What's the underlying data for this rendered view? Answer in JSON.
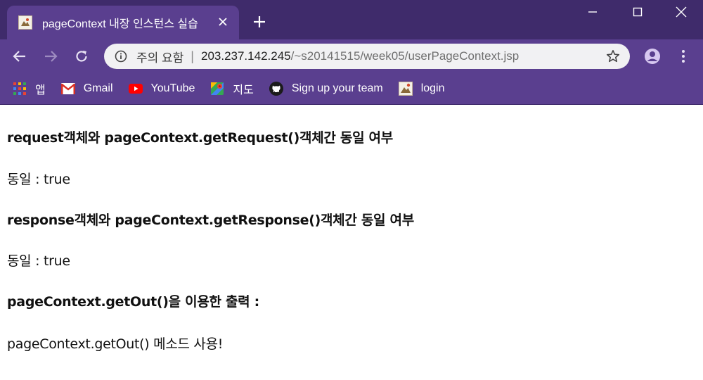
{
  "colors": {
    "frame": "#3f2b6b",
    "toolbar": "#5a3f8f",
    "omnibox": "#f1f1f3",
    "page_text": "#111111"
  },
  "tab": {
    "title": "pageContext 내장 인스턴스 실습",
    "favicon": "page-favicon-icon",
    "close_icon": "close-icon"
  },
  "new_tab_icon": "plus-icon",
  "window_controls": [
    "minimize-icon",
    "maximize-icon",
    "close-icon"
  ],
  "nav": {
    "back_icon": "back-arrow-icon",
    "forward_icon": "forward-arrow-icon",
    "reload_icon": "reload-icon"
  },
  "omnibox": {
    "security_label": "주의 요함",
    "separator": "|",
    "url_host": "203.237.142.245",
    "url_path": "/~s20141515/week05/userPageContext.jsp"
  },
  "bookmarks": [
    {
      "label": "앱",
      "icon": "apps-grid-icon"
    },
    {
      "label": "Gmail",
      "icon": "gmail-icon"
    },
    {
      "label": "YouTube",
      "icon": "youtube-icon"
    },
    {
      "label": "지도",
      "icon": "maps-icon"
    },
    {
      "label": "Sign up your team",
      "icon": "github-icon"
    },
    {
      "label": "login",
      "icon": "page-favicon-icon"
    }
  ],
  "page": {
    "heading1": "request객체와 pageContext.getRequest()객체간 동일 여부",
    "result1": "동일 : true",
    "heading2": "response객체와 pageContext.getResponse()객체간 동일 여부",
    "result2": "동일 : true",
    "heading3": "pageContext.getOut()을 이용한 출력 :",
    "output": "pageContext.getOut() 메소드 사용!"
  }
}
